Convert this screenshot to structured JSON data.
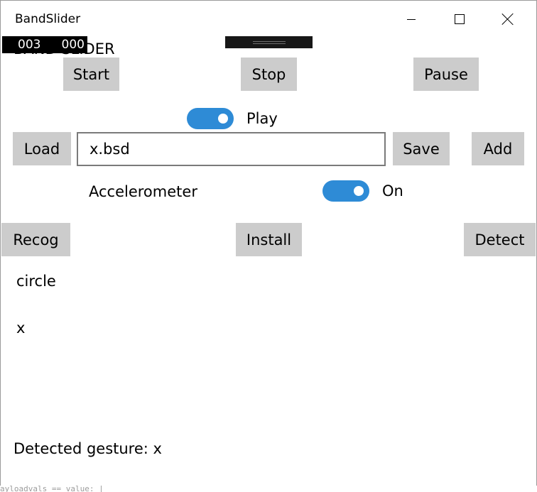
{
  "window": {
    "title": "BandSlider",
    "controls": {
      "minimize": "minimize-icon",
      "maximize": "maximize-icon",
      "close": "close-icon"
    }
  },
  "counter": {
    "left": "003",
    "right": "000"
  },
  "app_title": "BAND SLIDER",
  "transport": {
    "start": "Start",
    "stop": "Stop",
    "pause": "Pause"
  },
  "play_toggle": {
    "label": "Play",
    "on": true
  },
  "file": {
    "load": "Load",
    "value": "x.bsd",
    "save": "Save",
    "add": "Add"
  },
  "accelerometer": {
    "label": "Accelerometer",
    "state": "On",
    "on": true
  },
  "actions": {
    "recog": "Recog",
    "install": "Install",
    "detect": "Detect"
  },
  "gestures": {
    "first": "circle",
    "second": "x"
  },
  "status": "Detected gesture: x",
  "background_code_fragment": "ayloadvals == value: |",
  "colors": {
    "accent": "#2e8bd6",
    "button": "#cccccc",
    "counter_bg": "#000000"
  }
}
